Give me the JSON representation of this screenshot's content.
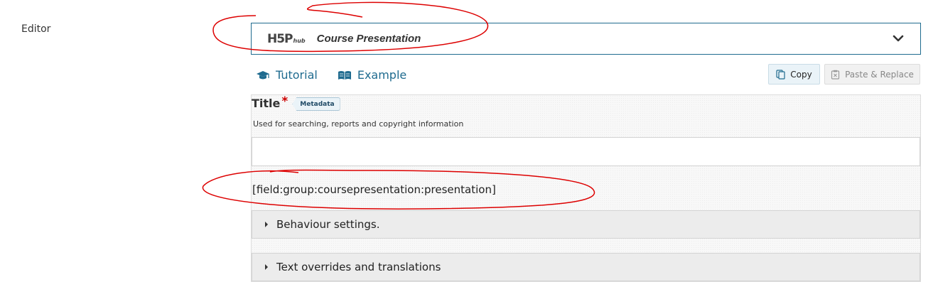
{
  "field": {
    "label": "Editor"
  },
  "hub": {
    "logo_main": "H5P",
    "logo_sub": "hub",
    "content_type": "Course Presentation",
    "icons": {
      "expand": "chevron-down-icon"
    }
  },
  "links": {
    "tutorial": {
      "label": "Tutorial",
      "icon": "graduation-cap-icon"
    },
    "example": {
      "label": "Example",
      "icon": "open-book-icon"
    }
  },
  "clipboard": {
    "copy_label": "Copy",
    "paste_label": "Paste & Replace",
    "copy_icon": "copy-icon",
    "paste_icon": "paste-icon"
  },
  "form": {
    "title_label": "Title",
    "required_marker": "*",
    "metadata_label": "Metadata",
    "title_description": "Used for searching, reports and copyright information",
    "title_value": "",
    "field_placeholder": "[field:group:coursepresentation:presentation]",
    "groups": [
      {
        "label": "Behaviour settings."
      },
      {
        "label": "Text overrides and translations"
      }
    ]
  },
  "colors": {
    "accent": "#1f6b8f",
    "required": "#cc0000",
    "annotation": "#dd0000"
  }
}
